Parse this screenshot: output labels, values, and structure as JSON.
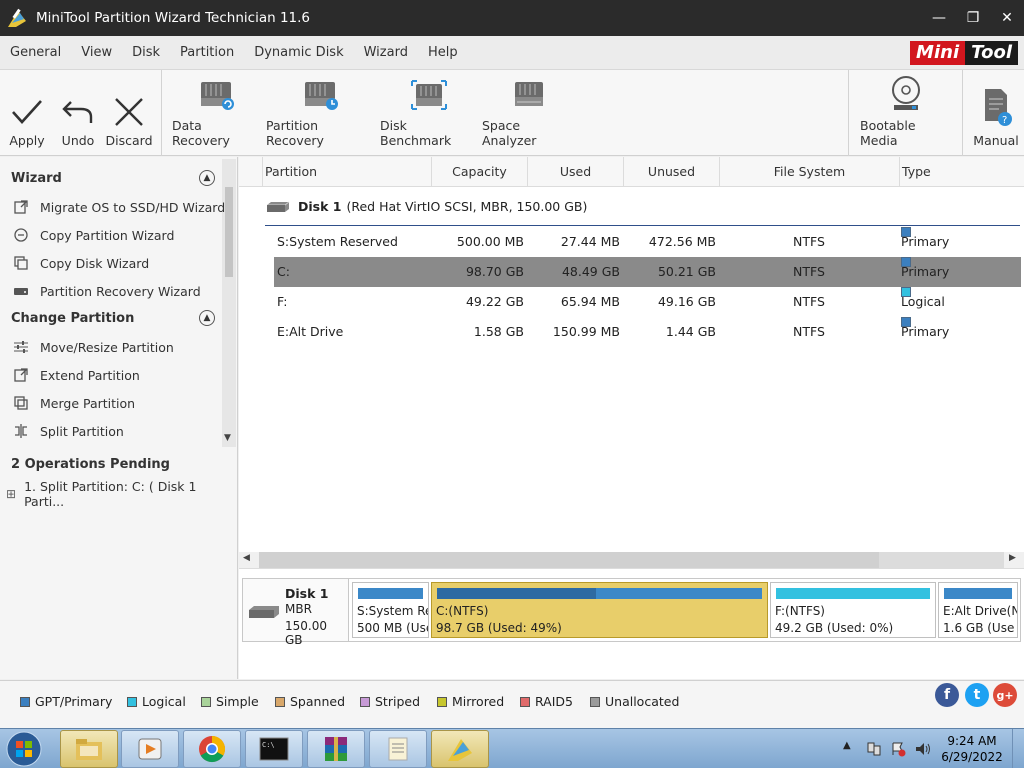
{
  "window": {
    "title": "MiniTool Partition Wizard Technician 11.6",
    "controls": {
      "minimize": "—",
      "maximize": "❐",
      "close": "✕"
    }
  },
  "menu": [
    "General",
    "View",
    "Disk",
    "Partition",
    "Dynamic Disk",
    "Wizard",
    "Help"
  ],
  "brand": {
    "part1": "Mini",
    "part2": "Tool"
  },
  "toolbar": {
    "apply": "Apply",
    "undo": "Undo",
    "discard": "Discard",
    "data_recovery": "Data Recovery",
    "partition_recovery": "Partition Recovery",
    "disk_benchmark": "Disk Benchmark",
    "space_analyzer": "Space Analyzer",
    "bootable_media": "Bootable Media",
    "manual": "Manual"
  },
  "left_panel": {
    "wizard_title": "Wizard",
    "wizard_items": [
      "Migrate OS to SSD/HD Wizard",
      "Copy Partition Wizard",
      "Copy Disk Wizard",
      "Partition Recovery Wizard"
    ],
    "change_title": "Change Partition",
    "change_items": [
      "Move/Resize Partition",
      "Extend Partition",
      "Merge Partition",
      "Split Partition"
    ],
    "pending_title": "2 Operations Pending",
    "pending_items": [
      "1. Split Partition: C: ( Disk 1 Parti..."
    ],
    "tree_toggle": "⊞"
  },
  "table": {
    "headers": [
      "Partition",
      "Capacity",
      "Used",
      "Unused",
      "File System",
      "Type"
    ],
    "disk_label": "Disk 1",
    "disk_desc": "(Red Hat VirtIO SCSI, MBR, 150.00 GB)",
    "rows": [
      {
        "partition": "S:System Reserved",
        "capacity": "500.00 MB",
        "used": "27.44 MB",
        "unused": "472.56 MB",
        "fs": "NTFS",
        "type": "Primary"
      },
      {
        "partition": "C:",
        "capacity": "98.70 GB",
        "used": "48.49 GB",
        "unused": "50.21 GB",
        "fs": "NTFS",
        "type": "Primary"
      },
      {
        "partition": "F:",
        "capacity": "49.22 GB",
        "used": "65.94 MB",
        "unused": "49.16 GB",
        "fs": "NTFS",
        "type": "Logical"
      },
      {
        "partition": "E:Alt Drive",
        "capacity": "1.58 GB",
        "used": "150.99 MB",
        "unused": "1.44 GB",
        "fs": "NTFS",
        "type": "Primary"
      }
    ]
  },
  "disk_map": {
    "disk_name": "Disk 1",
    "disk_style": "MBR",
    "disk_size": "150.00 GB",
    "parts": [
      {
        "l1": "S:System Re",
        "l2": "500 MB (Use"
      },
      {
        "l1": "C:(NTFS)",
        "l2": "98.7 GB (Used: 49%)"
      },
      {
        "l1": "F:(NTFS)",
        "l2": "49.2 GB (Used: 0%)"
      },
      {
        "l1": "E:Alt Drive(N",
        "l2": "1.6 GB (Use"
      }
    ]
  },
  "legend": [
    "GPT/Primary",
    "Logical",
    "Simple",
    "Spanned",
    "Striped",
    "Mirrored",
    "RAID5",
    "Unallocated"
  ],
  "legend_colors": [
    "#3b7fbf",
    "#33c1e0",
    "#a9d39a",
    "#d9a86b",
    "#c79ad6",
    "#c7c72e",
    "#e06a6a",
    "#9a9a9a"
  ],
  "social": {
    "facebook": "f",
    "twitter": "t",
    "google": "g+"
  },
  "clock": {
    "time": "9:24 AM",
    "date": "6/29/2022"
  },
  "colors": {
    "accent_primary": "#3b7fbf",
    "accent_logical": "#33c1e0",
    "selected_row": "#8a8a8a",
    "selected_part": "#e8ce6a"
  }
}
